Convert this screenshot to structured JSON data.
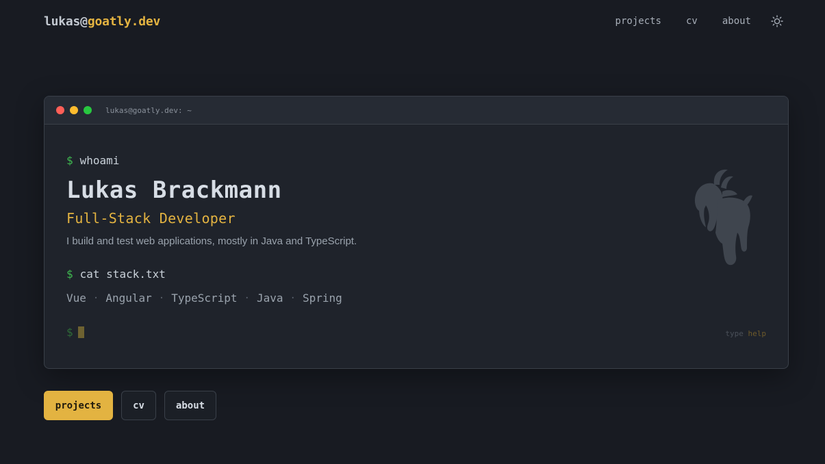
{
  "header": {
    "logo_user": "lukas@",
    "logo_domain": "goatly.dev",
    "nav": [
      "projects",
      "cv",
      "about"
    ]
  },
  "terminal": {
    "title": "lukas@goatly.dev: ~",
    "prompt": "$",
    "cmd1": "whoami",
    "name": "Lukas Brackmann",
    "role": "Full-Stack Developer",
    "description": "I build and test web applications, mostly in Java and TypeScript.",
    "cmd2": "cat stack.txt",
    "stack": [
      "Vue",
      "Angular",
      "TypeScript",
      "Java",
      "Spring"
    ],
    "stack_separator": "·",
    "hint_prefix": "type",
    "hint_keyword": "help"
  },
  "buttons": [
    "projects",
    "cv",
    "about"
  ],
  "colors": {
    "accent": "#e3b341",
    "prompt_green": "#3fb950",
    "background": "#181b22"
  }
}
